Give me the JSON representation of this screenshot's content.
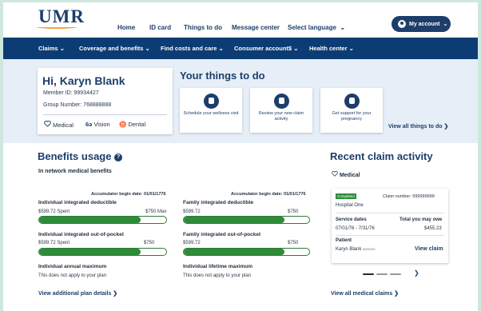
{
  "header": {
    "logo": "UMR",
    "nav": [
      "Home",
      "ID card",
      "Things to do",
      "Message center",
      "Select language"
    ],
    "account_label": "My account"
  },
  "menu": [
    "Claims",
    "Coverage and benefits",
    "Find costs and care",
    "Consumer account$",
    "Health center"
  ],
  "user": {
    "greeting": "Hi, Karyn Blank",
    "member_id": "Member ID: 99934427",
    "group_number": "Group Number: 768888888",
    "coverage": [
      "Medical",
      "Vision",
      "Dental"
    ]
  },
  "things": {
    "title": "Your things to do",
    "tiles": [
      {
        "text": "Schedule your wellness visit",
        "icon": "leaf-icon"
      },
      {
        "text": "Review your new claim activity",
        "icon": "clipboard-icon"
      },
      {
        "text": "Get support for your pregnancy",
        "icon": "baby-icon"
      }
    ],
    "view_all": "View all things to do"
  },
  "benefits": {
    "title": "Benefits usage",
    "subtitle": "In network medical benefits",
    "accumulator_left": "Accumulator begin date: 01/01/1776",
    "accumulator_right": "Accumulator begin date: 01/01/1776",
    "items": [
      {
        "label": "Individual integrated deductible",
        "spent": "$599.72 Spent",
        "max": "$750 Max",
        "progress": 0.8
      },
      {
        "label": "Family integrated deductible",
        "spent": "$599.72",
        "max": "$750",
        "progress": 0.8
      },
      {
        "label": "Individual integrated out-of-pocket",
        "spent": "$599.72 Spent",
        "max": "$750",
        "progress": 0.8
      },
      {
        "label": "Family integrated out-of-pocket",
        "spent": "$599.72",
        "max": "$750",
        "progress": 0.8
      }
    ],
    "annual_max_label": "Individual annual maximum",
    "annual_max_value": "This does not apply to your plan",
    "lifetime_max_label": "Individual lifetime maximum",
    "lifetime_max_value": "This does not apply to your plan",
    "view_more": "View additional plan details"
  },
  "claims": {
    "title": "Recent claim activity",
    "category": "Medical",
    "badge": "Completed",
    "claim_number": "Claim number: 999999999",
    "provider": "Hospital One",
    "service_dates_label": "Service dates",
    "service_dates": "07/01/76 - 7/31/76",
    "owe_label": "Total you may owe",
    "owe": "$455.23",
    "patient_label": "Patient",
    "patient": "Karyn Blank",
    "patient_dob": "00/01/32",
    "view_claim": "View claim",
    "view_all": "View all medical claims"
  },
  "colors": {
    "brand": "#1d3e6b",
    "nav": "#0d3c74",
    "progress": "#2e8b3a",
    "hero_bg": "#e6eef7",
    "page_bg": "#cfe8df"
  }
}
